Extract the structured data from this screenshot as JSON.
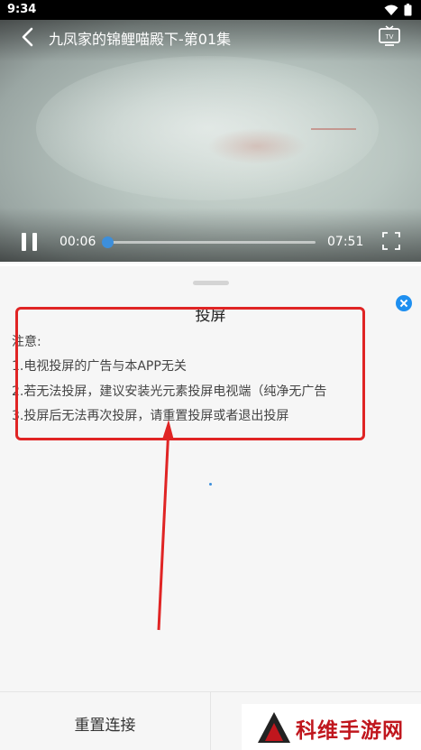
{
  "status_bar": {
    "time": "9:34"
  },
  "player": {
    "title": "九凤家的锦鲤喵殿下-第01集",
    "current_time": "00:06",
    "total_time": "07:51",
    "progress": 0.013
  },
  "sheet": {
    "title": "投屏",
    "notice_label": "注意:",
    "notices": [
      "1.电视投屏的广告与本APP无关",
      "2.若无法投屏，建议安装光元素投屏电视端（纯净无广告",
      "3.投屏后无法再次投屏，请重置投屏或者退出投屏"
    ],
    "reset_button": "重置连接"
  },
  "watermark": {
    "text": "科维手游网"
  },
  "colors": {
    "accent": "#1e8ff0",
    "annotation": "#e02424",
    "watermark": "#c0161d"
  }
}
